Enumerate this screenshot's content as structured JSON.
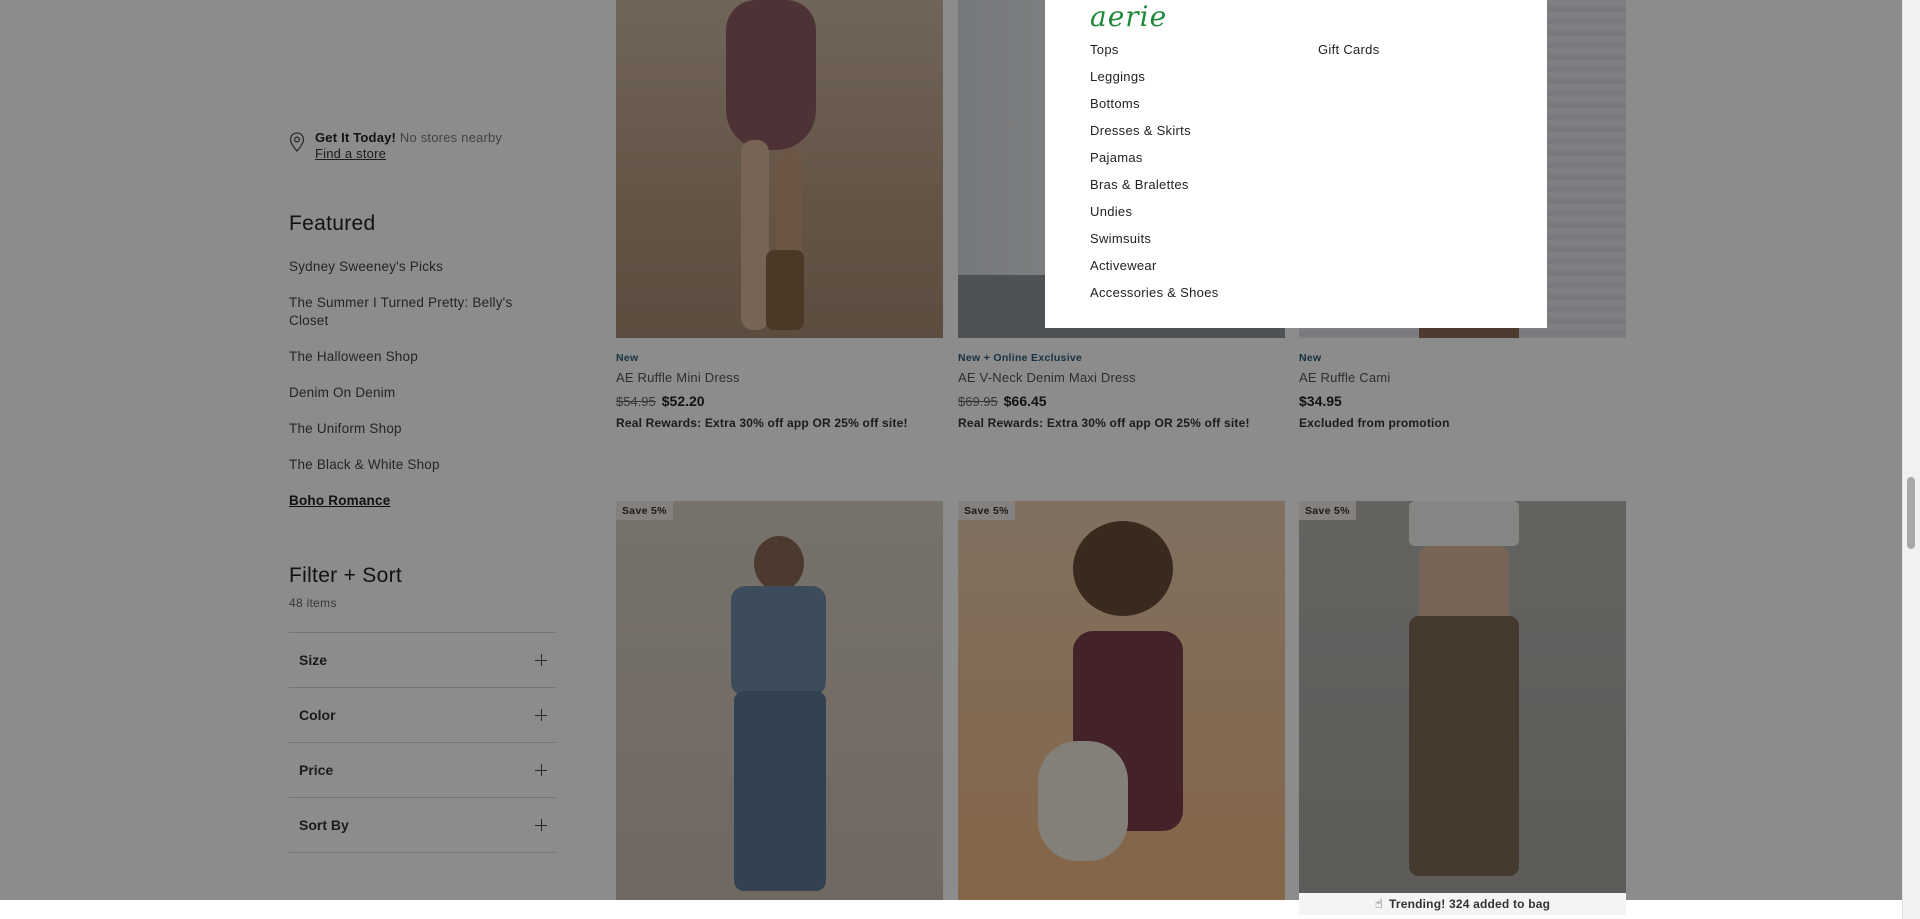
{
  "store": {
    "title": "Get It Today!",
    "status": "No stores nearby",
    "link": "Find a store"
  },
  "featured": {
    "title": "Featured",
    "items": [
      {
        "label": "Sydney Sweeney's Picks"
      },
      {
        "label": "The Summer I Turned Pretty: Belly's Closet"
      },
      {
        "label": "The Halloween Shop"
      },
      {
        "label": "Denim On Denim"
      },
      {
        "label": "The Uniform Shop"
      },
      {
        "label": "The Black & White Shop"
      },
      {
        "label": "Boho Romance"
      }
    ]
  },
  "filter": {
    "title": "Filter + Sort",
    "count": "48 items",
    "rows": [
      {
        "label": "Size"
      },
      {
        "label": "Color"
      },
      {
        "label": "Price"
      },
      {
        "label": "Sort By"
      }
    ]
  },
  "products_top": [
    {
      "tag": "New",
      "name": "AE Ruffle Mini Dress",
      "old_price": "$54.95",
      "price": "$52.20",
      "promo": "Real Rewards: Extra 30% off app OR 25% off site!"
    },
    {
      "tag": "New + Online Exclusive",
      "name": "AE V-Neck Denim Maxi Dress",
      "old_price": "$69.95",
      "price": "$66.45",
      "promo": "Real Rewards: Extra 30% off app OR 25% off site!"
    },
    {
      "tag": "New",
      "name": "AE Ruffle Cami",
      "old_price": "",
      "price": "$34.95",
      "promo": "Excluded from promotion"
    }
  ],
  "products_bottom": [
    {
      "badge": "Save 5%"
    },
    {
      "badge": "Save 5%"
    },
    {
      "badge": "Save 5%"
    }
  ],
  "menu": {
    "brand": "aerie",
    "col1": [
      "Tops",
      "Leggings",
      "Bottoms",
      "Dresses & Skirts",
      "Pajamas",
      "Bras & Bralettes",
      "Undies",
      "Swimsuits",
      "Activewear",
      "Accessories & Shoes"
    ],
    "col2": [
      "Gift Cards"
    ]
  },
  "toast": {
    "icon": "hand-icon",
    "text": "Trending! 324 added to bag"
  },
  "colors": {
    "brand_green": "#1e8a3a",
    "tag_blue": "#2a5c7a",
    "overlay": "rgba(0,0,0,0.45)"
  }
}
